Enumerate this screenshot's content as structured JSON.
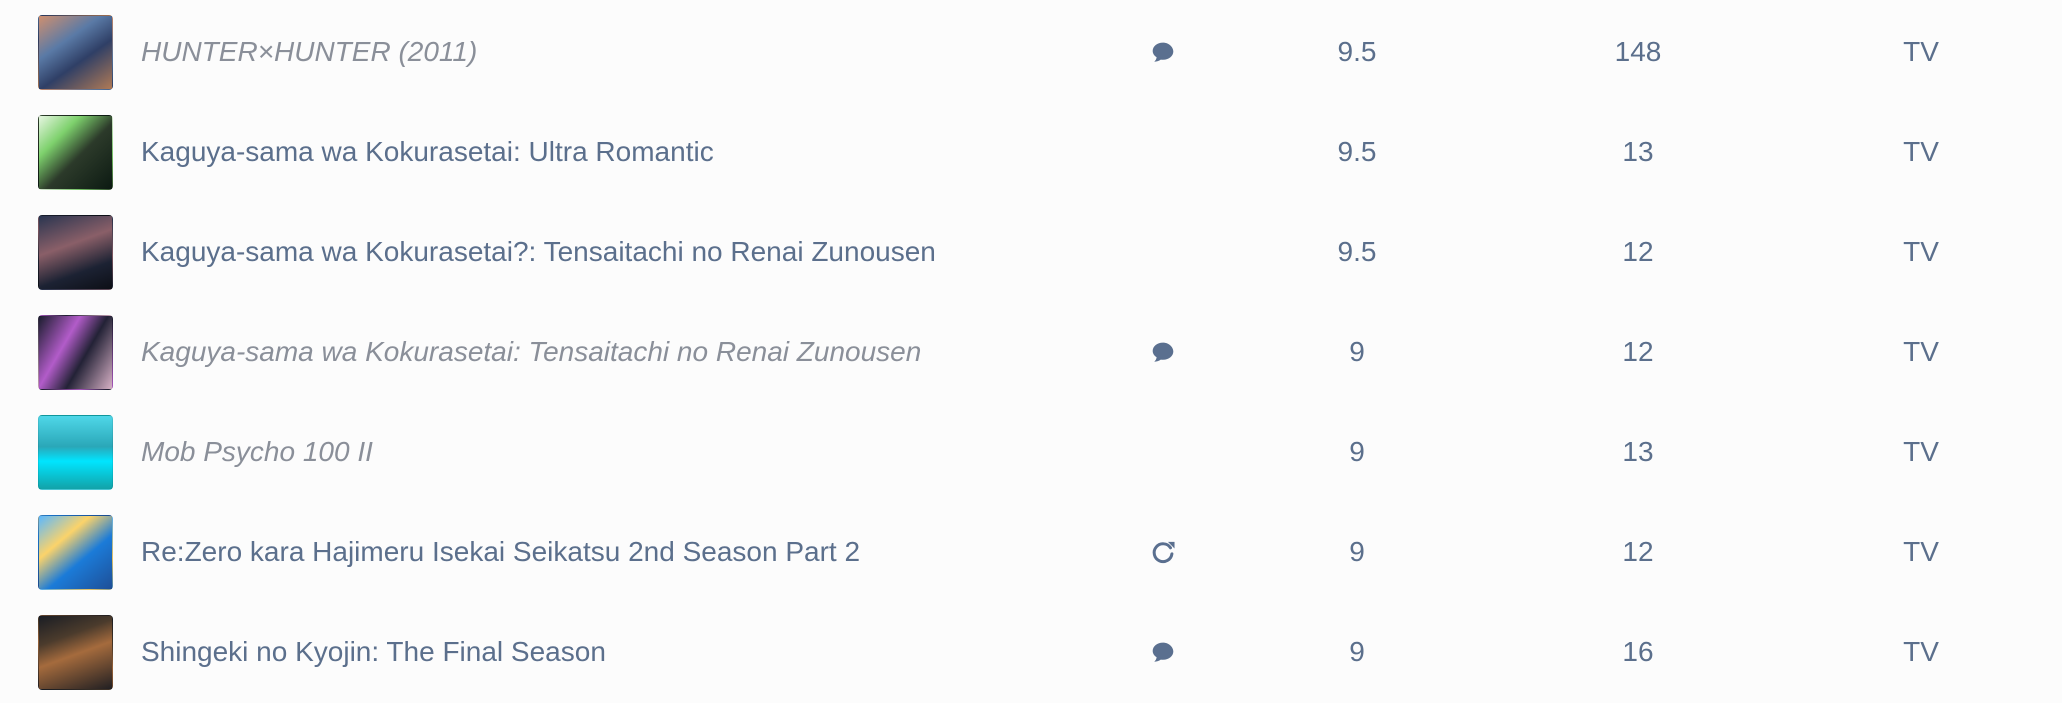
{
  "rows": [
    {
      "title": "HUNTER×HUNTER (2011)",
      "score": "9.5",
      "episodes": "148",
      "type": "TV",
      "icon": "comment-icon",
      "style": "italic"
    },
    {
      "title": "Kaguya-sama wa Kokurasetai: Ultra Romantic",
      "score": "9.5",
      "episodes": "13",
      "type": "TV",
      "icon": "",
      "style": "normal"
    },
    {
      "title": "Kaguya-sama wa Kokurasetai?: Tensaitachi no Renai Zunousen",
      "score": "9.5",
      "episodes": "12",
      "type": "TV",
      "icon": "",
      "style": "normal"
    },
    {
      "title": "Kaguya-sama wa Kokurasetai: Tensaitachi no Renai Zunousen",
      "score": "9",
      "episodes": "12",
      "type": "TV",
      "icon": "comment-icon",
      "style": "italic"
    },
    {
      "title": "Mob Psycho 100 II",
      "score": "9",
      "episodes": "13",
      "type": "TV",
      "icon": "",
      "style": "italic"
    },
    {
      "title": "Re:Zero kara Hajimeru Isekai Seikatsu 2nd Season Part 2",
      "score": "9",
      "episodes": "12",
      "type": "TV",
      "icon": "refresh-icon",
      "style": "normal"
    },
    {
      "title": "Shingeki no Kyojin: The Final Season",
      "score": "9",
      "episodes": "16",
      "type": "TV",
      "icon": "comment-icon",
      "style": "normal"
    }
  ],
  "colors": {
    "text": "#5b6f8c",
    "muted_italic": "#8a8f99",
    "icon": "#5a6f8f",
    "background": "#fcfcfc"
  }
}
